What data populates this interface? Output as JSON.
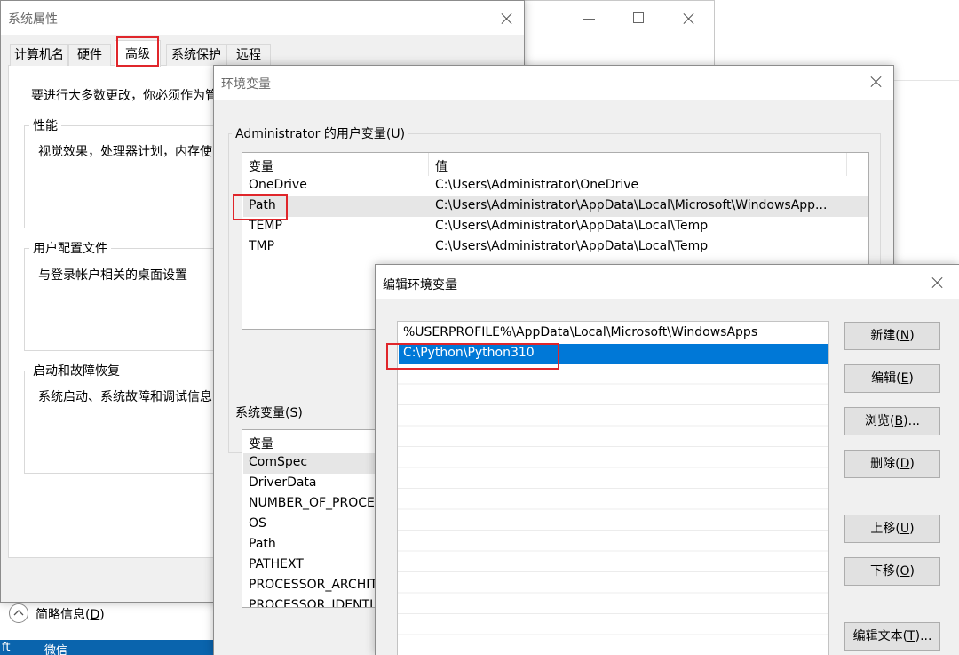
{
  "system_properties": {
    "title": "系统属性",
    "tabs": [
      "计算机名",
      "硬件",
      "高级",
      "系统保护",
      "远程"
    ],
    "admin_notice": "要进行大多数更改，你必须作为管",
    "performance": {
      "legend": "性能",
      "text": "视觉效果，处理器计划，内存使"
    },
    "user_profiles": {
      "legend": "用户配置文件",
      "text": "与登录帐户相关的桌面设置"
    },
    "startup_recovery": {
      "legend": "启动和故障恢复",
      "text": "系统启动、系统故障和调试信息"
    }
  },
  "summary_link": {
    "label": "简略信息(",
    "key": "D",
    "suffix": ")"
  },
  "taskbar": {
    "left_text": "ft",
    "wechat": "微信"
  },
  "env_vars": {
    "title": "环境变量",
    "user_section_label": "Administrator 的用户变量(U)",
    "columns": [
      "变量",
      "值"
    ],
    "user_vars": [
      {
        "name": "OneDrive",
        "value": "C:\\Users\\Administrator\\OneDrive"
      },
      {
        "name": "Path",
        "value": "C:\\Users\\Administrator\\AppData\\Local\\Microsoft\\WindowsApp..."
      },
      {
        "name": "TEMP",
        "value": "C:\\Users\\Administrator\\AppData\\Local\\Temp"
      },
      {
        "name": "TMP",
        "value": "C:\\Users\\Administrator\\AppData\\Local\\Temp"
      }
    ],
    "system_section_label": "系统变量(S)",
    "system_column": "变量",
    "system_vars": [
      "ComSpec",
      "DriverData",
      "NUMBER_OF_PROCE",
      "OS",
      "Path",
      "PATHEXT",
      "PROCESSOR_ARCHIT",
      "PROCESSOR_IDENTI"
    ]
  },
  "edit_env": {
    "title": "编辑环境变量",
    "entries": [
      "%USERPROFILE%\\AppData\\Local\\Microsoft\\WindowsApps",
      "C:\\Python\\Python310"
    ],
    "buttons": {
      "new": {
        "label": "新建(",
        "key": "N",
        "suffix": ")"
      },
      "edit": {
        "label": "编辑(",
        "key": "E",
        "suffix": ")"
      },
      "browse": {
        "label": "浏览(",
        "key": "B",
        "suffix": ")..."
      },
      "delete": {
        "label": "删除(",
        "key": "D",
        "suffix": ")"
      },
      "move_up": {
        "label": "上移(",
        "key": "U",
        "suffix": ")"
      },
      "move_down": {
        "label": "下移(",
        "key": "O",
        "suffix": ")"
      },
      "edit_text": {
        "label": "编辑文本(",
        "key": "T",
        "suffix": ")..."
      }
    }
  }
}
